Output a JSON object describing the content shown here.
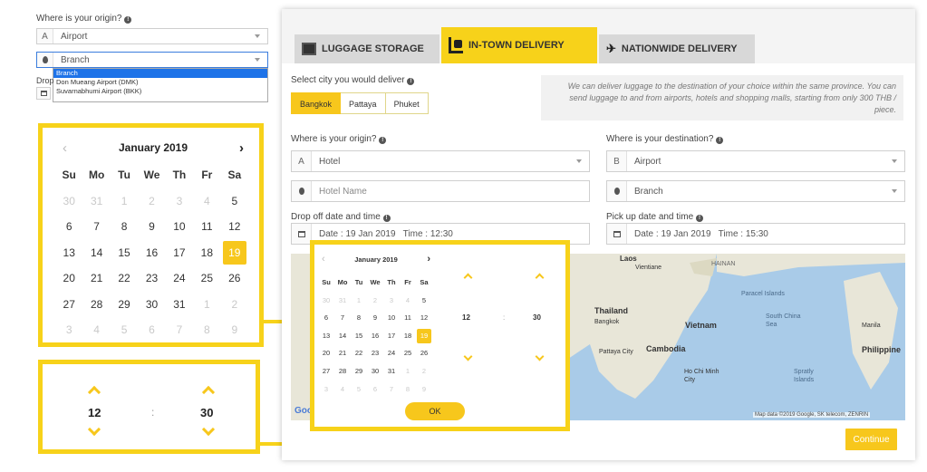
{
  "left_form": {
    "origin_label": "Where is your origin?",
    "prefix_a": "A",
    "origin_value": "Airport",
    "branch_value": "Branch",
    "dropdown_options": [
      "Branch",
      "Don Mueang Airport (DMK)",
      "Suvarnabhumi Airport (BKK)"
    ],
    "drop_label_partial": "Drop"
  },
  "big_calendar": {
    "month": "January 2019",
    "weekdays": [
      "Su",
      "Mo",
      "Tu",
      "We",
      "Th",
      "Fr",
      "Sa"
    ],
    "weeks": [
      [
        "30",
        "31",
        "1",
        "2",
        "3",
        "4",
        "5"
      ],
      [
        "6",
        "7",
        "8",
        "9",
        "10",
        "11",
        "12"
      ],
      [
        "13",
        "14",
        "15",
        "16",
        "17",
        "18",
        "19"
      ],
      [
        "20",
        "21",
        "22",
        "23",
        "24",
        "25",
        "26"
      ],
      [
        "27",
        "28",
        "29",
        "30",
        "31",
        "1",
        "2"
      ],
      [
        "3",
        "4",
        "5",
        "6",
        "7",
        "8",
        "9"
      ]
    ],
    "selected": "19"
  },
  "big_time": {
    "hour": "12",
    "sep": ":",
    "minute": "30"
  },
  "panel": {
    "tabs": [
      {
        "label": "LUGGAGE STORAGE",
        "icon": "storage-icon"
      },
      {
        "label": "IN-TOWN DELIVERY",
        "icon": "luggage-cart-icon"
      },
      {
        "label": "NATIONWIDE DELIVERY",
        "icon": "airplane-icon"
      }
    ],
    "city_prompt": "Select city you would deliver",
    "cities": [
      "Bangkok",
      "Pattaya",
      "Phuket"
    ],
    "info": "We can deliver luggage to the destination of your choice within the same province. You can send luggage to and from airports, hotels and shopping malls, starting from only 300 THB / piece.",
    "origin_label": "Where is your origin?",
    "origin_prefix": "A",
    "origin_value": "Hotel",
    "hotel_placeholder": "Hotel Name",
    "dest_label": "Where is your destination?",
    "dest_prefix": "B",
    "dest_value": "Airport",
    "dest_branch": "Branch",
    "dropoff_label": "Drop off date and time",
    "dropoff_value": "Date : 19 Jan 2019   Time : 12:30",
    "pickup_label": "Pick up date and time",
    "pickup_value": "Date : 19 Jan 2019   Time : 15:30",
    "continue": "Continue"
  },
  "small_calendar": {
    "month": "January 2019",
    "weekdays": [
      "Su",
      "Mo",
      "Tu",
      "We",
      "Th",
      "Fr",
      "Sa"
    ],
    "weeks": [
      [
        "30",
        "31",
        "1",
        "2",
        "3",
        "4",
        "5"
      ],
      [
        "6",
        "7",
        "8",
        "9",
        "10",
        "11",
        "12"
      ],
      [
        "13",
        "14",
        "15",
        "16",
        "17",
        "18",
        "19"
      ],
      [
        "20",
        "21",
        "22",
        "23",
        "24",
        "25",
        "26"
      ],
      [
        "27",
        "28",
        "29",
        "30",
        "31",
        "1",
        "2"
      ],
      [
        "3",
        "4",
        "5",
        "6",
        "7",
        "8",
        "9"
      ]
    ],
    "selected": "19",
    "hour": "12",
    "sep": ":",
    "minute": "30",
    "ok": "OK"
  },
  "map": {
    "labels": [
      "Laos",
      "Vientiane",
      "Thailand",
      "Bangkok",
      "Vietnam",
      "Cambodia",
      "Ho Chi Minh City",
      "Pattaya City",
      "HAINAN",
      "Paracel Islands",
      "South China Sea",
      "Philippine",
      "Manila",
      "Spratly Islands"
    ],
    "credit": "Map data ©2019 Google, SK telecom, ZENRIN",
    "google": "Google"
  }
}
